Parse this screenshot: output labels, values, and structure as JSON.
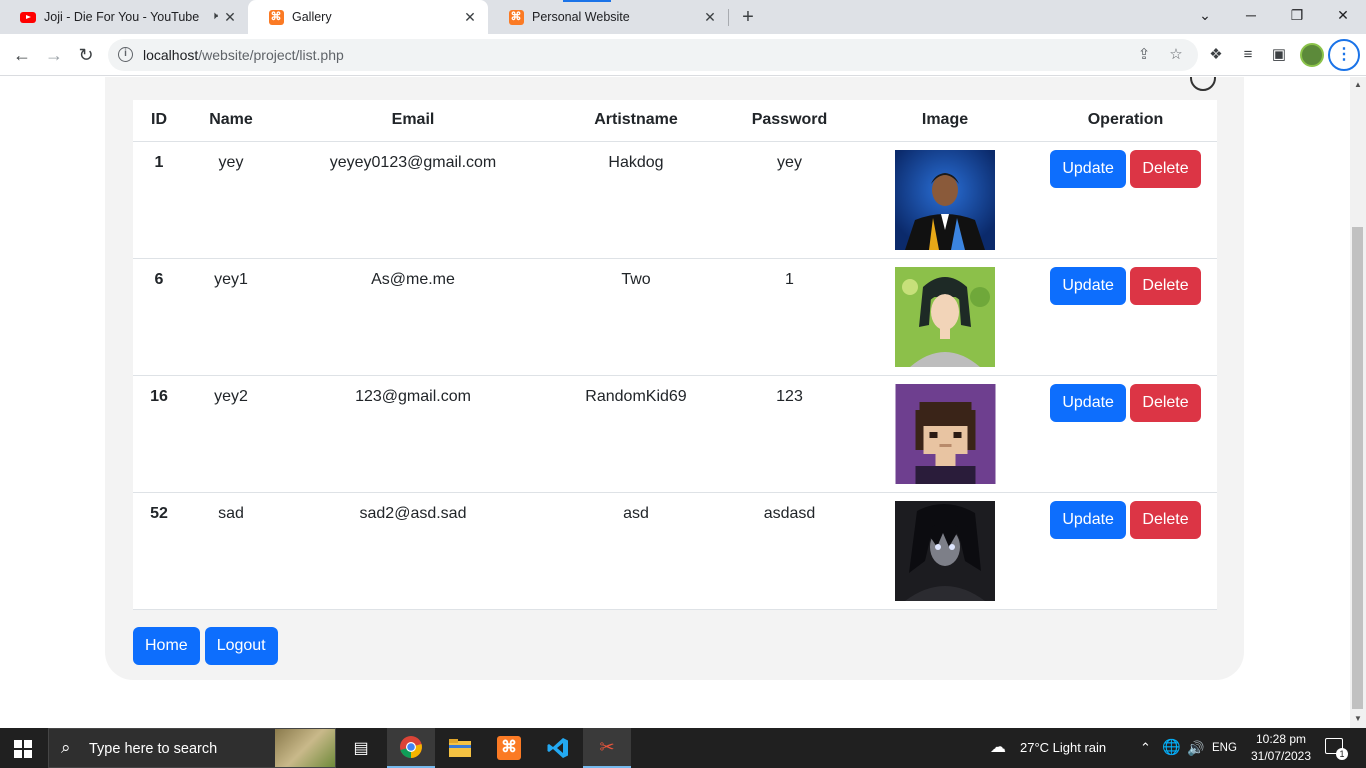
{
  "browser": {
    "tabs": [
      {
        "title": "Joji - Die For You - YouTube",
        "favicon": "youtube-icon",
        "audio": "speaker-icon"
      },
      {
        "title": "Gallery",
        "favicon": "xampp-icon"
      },
      {
        "title": "Personal Website",
        "favicon": "xampp-icon"
      }
    ],
    "active_tab": 1,
    "address": {
      "host": "localhost",
      "path": "/website/project/list.php"
    }
  },
  "table": {
    "headers": [
      "ID",
      "Name",
      "Email",
      "Artistname",
      "Password",
      "Image",
      "Operation"
    ],
    "rows": [
      {
        "id": "1",
        "name": "yey",
        "email": "yeyey0123@gmail.com",
        "artist": "Hakdog",
        "password": "yey",
        "image": "graduation-portrait",
        "update": "Update",
        "delete": "Delete"
      },
      {
        "id": "6",
        "name": "yey1",
        "email": "As@me.me",
        "artist": "Two",
        "password": "1",
        "image": "anime-girl-portrait",
        "update": "Update",
        "delete": "Delete"
      },
      {
        "id": "16",
        "name": "yey2",
        "email": "123@gmail.com",
        "artist": "RandomKid69",
        "password": "123",
        "image": "pixel-art-avatar",
        "update": "Update",
        "delete": "Delete"
      },
      {
        "id": "52",
        "name": "sad",
        "email": "sad2@asd.sad",
        "artist": "asd",
        "password": "asdasd",
        "image": "dark-anime-portrait",
        "update": "Update",
        "delete": "Delete"
      }
    ]
  },
  "actions": {
    "home": "Home",
    "logout": "Logout"
  },
  "taskbar": {
    "search_placeholder": "Type here to search",
    "weather": "27°C  Light rain",
    "lang": "ENG",
    "time": "10:28 pm",
    "date": "31/07/2023",
    "notification_count": "1"
  },
  "colors": {
    "primary": "#0d6efd",
    "danger": "#dc3545",
    "card_bg": "#f3f3f3"
  }
}
